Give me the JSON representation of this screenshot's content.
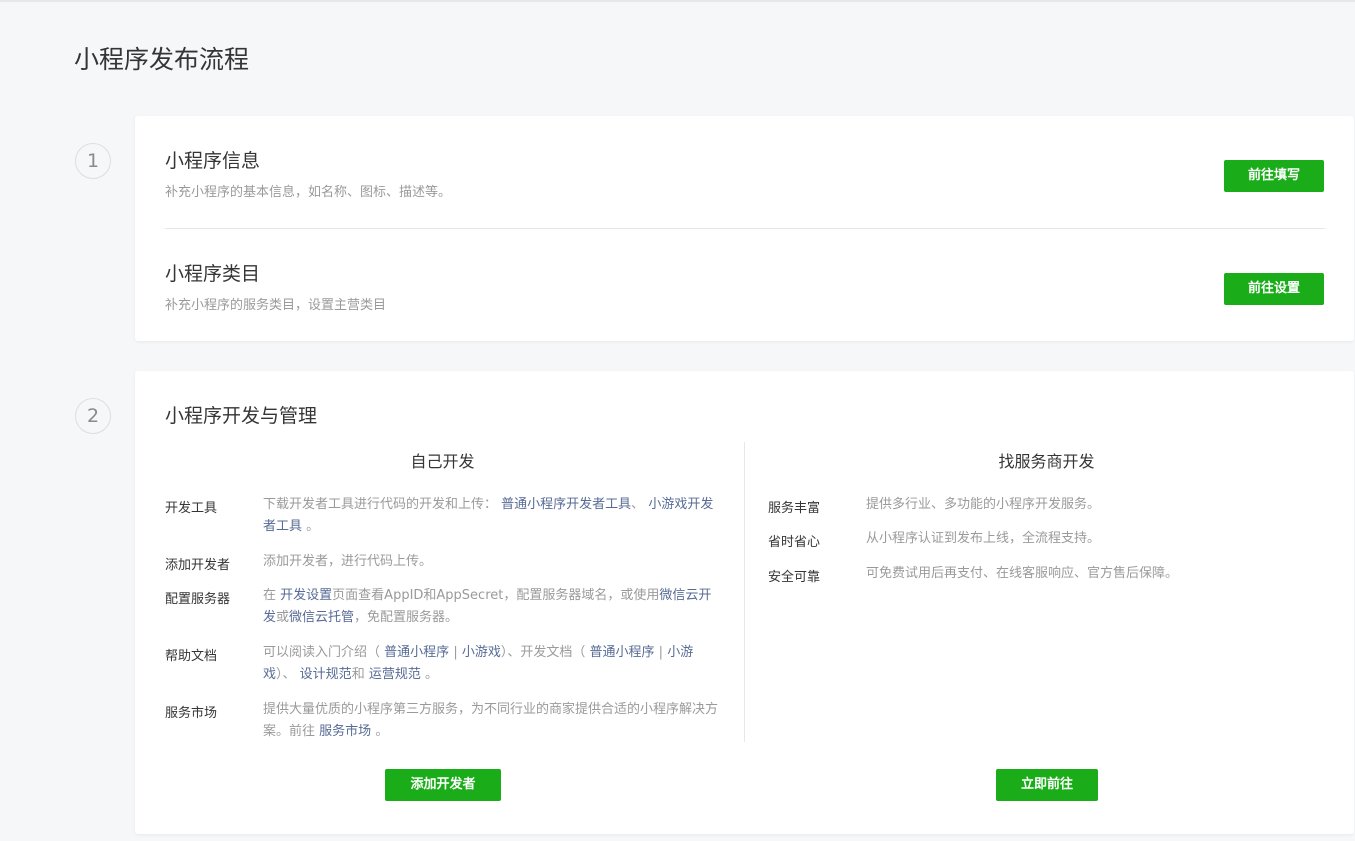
{
  "page": {
    "title": "小程序发布流程"
  },
  "step1": {
    "number": "1",
    "info": {
      "title": "小程序信息",
      "desc": "补充小程序的基本信息，如名称、图标、描述等。",
      "button": "前往填写"
    },
    "category": {
      "title": "小程序类目",
      "desc": "补充小程序的服务类目，设置主营类目",
      "button": "前往设置"
    }
  },
  "step2": {
    "number": "2",
    "title": "小程序开发与管理",
    "self": {
      "title": "自己开发",
      "devtools": {
        "label": "开发工具",
        "text1": "下载开发者工具进行代码的开发和上传：",
        "link1": "普通小程序开发者工具",
        "sep": "、",
        "link2": "小游戏开发者工具",
        "end": "。"
      },
      "add_dev": {
        "label": "添加开发者",
        "text": "添加开发者，进行代码上传。"
      },
      "server": {
        "label": "配置服务器",
        "t1": "在",
        "link1": "开发设置",
        "t2": "页面查看AppID和AppSecret，配置服务器域名，或使用",
        "link2": "微信云开发",
        "t3": "或",
        "link3": "微信云托管",
        "t4": "，免配置服务器。"
      },
      "docs": {
        "label": "帮助文档",
        "t1": "可以阅读入门介绍（",
        "link1": "普通小程序",
        "pipe1": "|",
        "link2": "小游戏",
        "t2": "）、开发文档（",
        "link3": "普通小程序",
        "pipe2": "|",
        "link4": "小游戏",
        "t3": "）、",
        "link5": "设计规范",
        "t4": "和",
        "link6": "运营规范",
        "t5": "。"
      },
      "market": {
        "label": "服务市场",
        "t1": "提供大量优质的小程序第三方服务，为不同行业的商家提供合适的小程序解决方案。前往",
        "link1": "服务市场",
        "t2": "。"
      },
      "button": "添加开发者"
    },
    "provider": {
      "title": "找服务商开发",
      "items": [
        {
          "label": "服务丰富",
          "text": "提供多行业、多功能的小程序开发服务。"
        },
        {
          "label": "省时省心",
          "text": "从小程序认证到发布上线，全流程支持。"
        },
        {
          "label": "安全可靠",
          "text": "可免费试用后再支付、在线客服响应、官方售后保障。"
        }
      ],
      "button": "立即前往"
    }
  },
  "colors": {
    "accent": "#1aad19",
    "link": "#576b95"
  }
}
